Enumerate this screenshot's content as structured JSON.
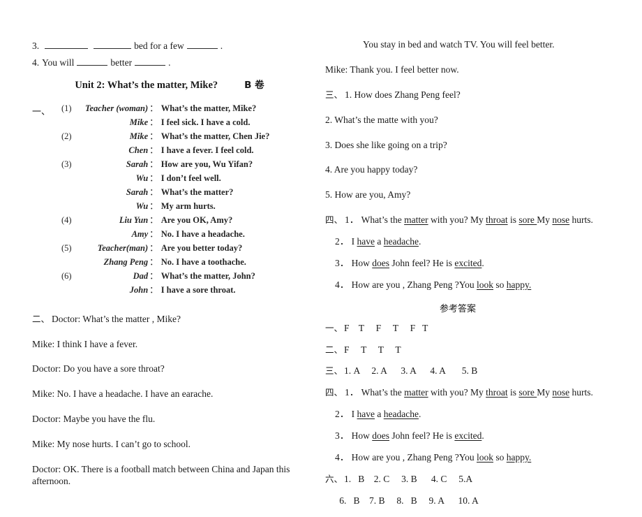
{
  "left": {
    "fill_items": [
      {
        "num": "3.",
        "segments": [
          {
            "type": "blank",
            "size": "b-long"
          },
          {
            "type": "blank",
            "size": "b-mid"
          },
          {
            "type": "text",
            "text": " bed for a few "
          },
          {
            "type": "blank",
            "size": "b-short"
          },
          {
            "type": "text",
            "text": "."
          }
        ]
      },
      {
        "num": "4.",
        "segments": [
          {
            "type": "text",
            "text": "You will "
          },
          {
            "type": "blank",
            "size": "b-short"
          },
          {
            "type": "text",
            "text": " better "
          },
          {
            "type": "blank",
            "size": "b-short"
          },
          {
            "type": "text",
            "text": "."
          }
        ]
      }
    ],
    "unit_title": "Unit 2: What’s the matter, Mike?",
    "unit_volume": "B 卷",
    "section_one_mark": "一、",
    "dialogues": [
      {
        "num": "(1)",
        "speaker": "Teacher (woman)",
        "colon": "：",
        "text": "What’s the matter, Mike?"
      },
      {
        "num": "",
        "speaker": "Mike",
        "colon": "：",
        "text": "I feel sick. I have a cold."
      },
      {
        "num": "(2)",
        "speaker": "Mike",
        "colon": "：",
        "text": "What’s the matter, Chen Jie?"
      },
      {
        "num": "",
        "speaker": "Chen",
        "colon": "：",
        "text": "I have a fever. I feel cold."
      },
      {
        "num": "(3)",
        "speaker": "Sarah",
        "colon": "：",
        "text": "How are you, Wu Yifan?"
      },
      {
        "num": "",
        "speaker": "Wu",
        "colon": "：",
        "text": "I don’t feel well."
      },
      {
        "num": "",
        "speaker": "Sarah",
        "colon": "：",
        "text": "What’s the matter?"
      },
      {
        "num": "",
        "speaker": "Wu",
        "colon": "：",
        "text": "My arm hurts."
      },
      {
        "num": "(4)",
        "speaker": "Liu Yun",
        "colon": "：",
        "text": "Are you OK, Amy?"
      },
      {
        "num": "",
        "speaker": "Amy",
        "colon": "：",
        "text": "No. I have a headache."
      },
      {
        "num": "(5)",
        "speaker": "Teacher(man)",
        "colon": "：",
        "text": "Are you better today?"
      },
      {
        "num": "",
        "speaker": "Zhang Peng",
        "colon": "：",
        "text": "No. I have a toothache."
      },
      {
        "num": "(6)",
        "speaker": "Dad",
        "colon": "：",
        "text": "What’s the matter, John?"
      },
      {
        "num": "",
        "speaker": "John",
        "colon": "：",
        "text": "I have a sore throat."
      }
    ],
    "section_two_mark": "二、",
    "section_two_lines": [
      "Doctor: What’s the matter , Mike?",
      "Mike: I think I have a fever.",
      "Doctor: Do you have a sore throat?",
      "Mike: No. I have a headache. I have an earache.",
      "Doctor: Maybe you have the flu.",
      "Mike: My nose hurts. I can’t go to school.",
      "Doctor: OK. There is a football match between China and Japan this afternoon."
    ]
  },
  "right": {
    "continued_line": "You stay in bed and watch TV. You will feel better.",
    "mike_reply": "Mike: Thank you. I feel better now.",
    "section_three_mark": "三、",
    "section_three_items": [
      "1. How does Zhang Peng feel?",
      "2. What’s the matte with you?",
      "3. Does she like going on a trip?",
      "4. Are you happy today?",
      "5. How are you, Amy?"
    ],
    "section_four_mark": "四、",
    "section_four_items": [
      {
        "num": "1．",
        "parts": [
          {
            "t": "What’s the ",
            "u": false
          },
          {
            "t": "matter",
            "u": true
          },
          {
            "t": " with you? My ",
            "u": false
          },
          {
            "t": "throat",
            "u": true
          },
          {
            "t": "   is ",
            "u": false
          },
          {
            "t": "sore ",
            "u": true
          },
          {
            "t": " My ",
            "u": false
          },
          {
            "t": "nose",
            "u": true
          },
          {
            "t": " hurts.",
            "u": false
          }
        ]
      },
      {
        "num": "2．",
        "parts": [
          {
            "t": "I ",
            "u": false
          },
          {
            "t": "have",
            "u": true
          },
          {
            "t": " a ",
            "u": false
          },
          {
            "t": "headache",
            "u": true
          },
          {
            "t": ".",
            "u": false
          }
        ]
      },
      {
        "num": "3．",
        "parts": [
          {
            "t": "How ",
            "u": false
          },
          {
            "t": "does",
            "u": true
          },
          {
            "t": " John feel? He is ",
            "u": false
          },
          {
            "t": "excited",
            "u": true
          },
          {
            "t": ".",
            "u": false
          }
        ]
      },
      {
        "num": "4．",
        "parts": [
          {
            "t": "How are you , Zhang Peng ?You ",
            "u": false
          },
          {
            "t": "look",
            "u": true
          },
          {
            "t": " so ",
            "u": false
          },
          {
            "t": "happy.",
            "u": true
          }
        ]
      }
    ],
    "answers_title": "参考答案",
    "answer_rows": [
      {
        "mark": "一、",
        "text": "F    T     F     T     F   T"
      },
      {
        "mark": "二、",
        "text": "F     T     T     T"
      },
      {
        "mark": "三、",
        "text": "1. A     2. A      3. A      4. A       5. B"
      }
    ],
    "section_four_repeat_mark": "四、",
    "section_six_mark": "六、",
    "section_six_rows": [
      "1.   B    2. C     3. B      4. C     5.A",
      "      6.   B    7. B     8.   B     9. A      10. A"
    ]
  }
}
